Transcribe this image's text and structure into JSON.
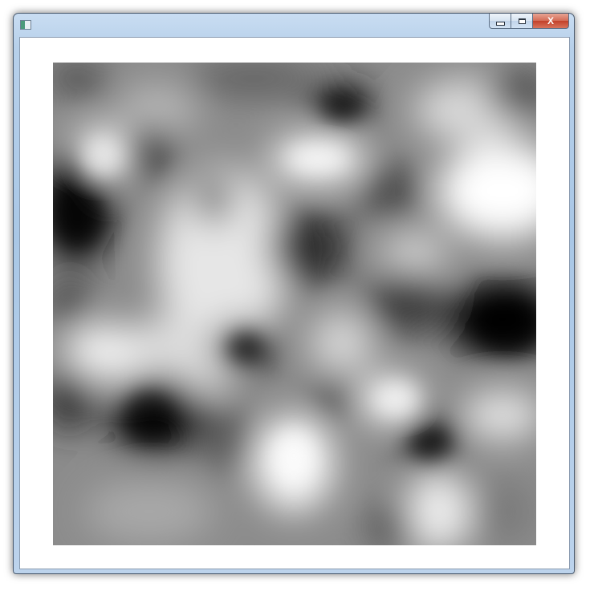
{
  "window": {
    "title": "",
    "caption_buttons": {
      "minimize_icon": "minimize-icon",
      "maximize_icon": "maximize-icon",
      "close_label": "X"
    },
    "frame_color": "#b7d0ea",
    "close_color": "#c2412a"
  },
  "content": {
    "image_icon": "grayscale-noise-image",
    "background": "#ffffff"
  }
}
